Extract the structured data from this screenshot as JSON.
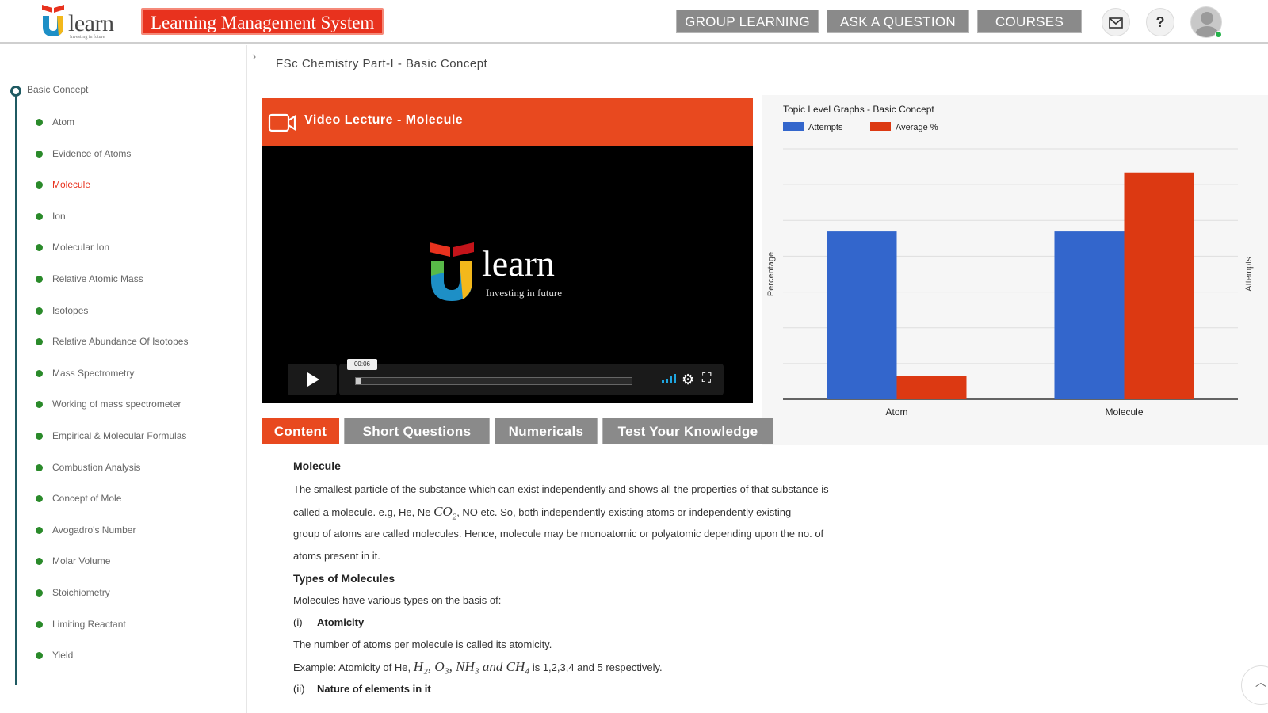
{
  "header": {
    "logo_text": "learn",
    "logo_tagline": "Investing in future",
    "app_title": "Learning Management System",
    "nav": [
      "GROUP LEARNING",
      "ASK A QUESTION",
      "COURSES"
    ],
    "mail_icon": "mail-icon",
    "help_label": "?"
  },
  "breadcrumb": "FSc Chemistry Part-I - Basic Concept",
  "sidebar": {
    "root": "Basic Concept",
    "items": [
      "Atom",
      "Evidence of Atoms",
      "Molecule",
      "Ion",
      "Molecular Ion",
      "Relative Atomic Mass",
      "Isotopes",
      "Relative Abundance Of Isotopes",
      "Mass Spectrometry",
      "Working of mass spectrometer",
      "Empirical & Molecular Formulas",
      "Combustion Analysis",
      "Concept of Mole",
      "Avogadro's Number",
      "Molar Volume",
      "Stoichiometry",
      "Limiting Reactant",
      "Yield"
    ],
    "active_index": 2
  },
  "video": {
    "title": "Video Lecture - Molecule",
    "logo_text": "learn",
    "logo_tagline": "Investing in future",
    "time": "00:06",
    "progress": 0.02
  },
  "chart_data": {
    "type": "bar",
    "title": "Topic Level Graphs - Basic Concept",
    "categories": [
      "Atom",
      "Molecule"
    ],
    "series": [
      {
        "name": "Attempts",
        "values": [
          57,
          57
        ],
        "color": "#3366cc"
      },
      {
        "name": "Average %",
        "values": [
          8,
          77
        ],
        "color": "#dc3912"
      }
    ],
    "ylabel": "Percentage",
    "y2label": "Attempts",
    "ylim": [
      0,
      85
    ],
    "grid": true,
    "legend": "top-left"
  },
  "tabs": [
    "Content",
    "Short Questions",
    "Numericals",
    "Test Your Knowledge"
  ],
  "active_tab": 0,
  "content": {
    "heading": "Molecule",
    "para1_line1": "The smallest particle of the substance which can exist independently and shows all the properties of that substance is",
    "para1_line2_a": "called a molecule. e.g, He, Ne",
    "para1_line2_math": "CO",
    "para1_line2_sub": "2",
    "para1_line2_b": ", NO etc. So, both independently existing atoms or independently existing",
    "para1_line3": "group of atoms are called molecules. Hence, molecule may be monoatomic or polyatomic depending upon the no. of",
    "para1_line4": "atoms present in it.",
    "types_heading": "Types of Molecules",
    "types_intro": "Molecules have various types on the basis of:",
    "item1_num": "(i)",
    "item1_label": "Atomicity",
    "atomicity_def": "The number of atoms per molecule is called its atomicity.",
    "example_a": "Example: Atomicity of He,",
    "example_math": "H₂, O₃, NH₃ and CH₄",
    "example_b": "is 1,2,3,4 and 5 respectively.",
    "item2_num": "(ii)",
    "item2_label": "Nature of elements in it"
  }
}
